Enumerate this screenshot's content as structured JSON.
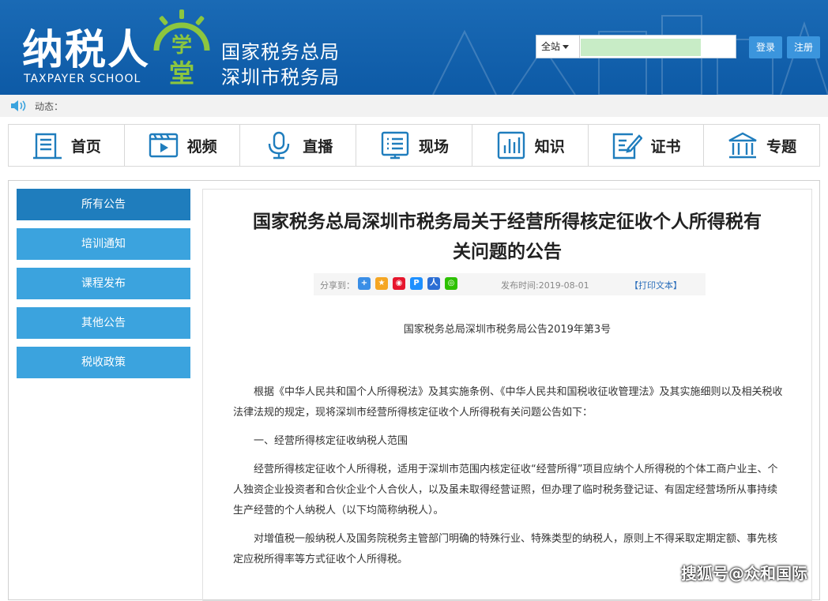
{
  "header": {
    "logo_text": "纳税人",
    "logo_sub": "TAXPAYER SCHOOL",
    "logo_emblem_chars": "学堂",
    "org_line1": "国家税务总局",
    "org_line2": "深圳市税务局",
    "search_scope": "全站",
    "search_value": "",
    "login_label": "登录",
    "register_label": "注册"
  },
  "ticker": {
    "label": "动态："
  },
  "nav": [
    {
      "label": "首页",
      "icon": "home-doc-icon"
    },
    {
      "label": "视频",
      "icon": "video-play-icon"
    },
    {
      "label": "直播",
      "icon": "microphone-icon"
    },
    {
      "label": "现场",
      "icon": "list-board-icon"
    },
    {
      "label": "知识",
      "icon": "bar-chart-icon"
    },
    {
      "label": "证书",
      "icon": "certificate-pen-icon"
    },
    {
      "label": "专题",
      "icon": "building-icon"
    }
  ],
  "sidebar": [
    {
      "label": "所有公告"
    },
    {
      "label": "培训通知"
    },
    {
      "label": "课程发布"
    },
    {
      "label": "其他公告"
    },
    {
      "label": "税收政策"
    }
  ],
  "article": {
    "title_line1": "国家税务总局深圳市税务局关于经营所得核定征收个人所得税有",
    "title_line2": "关问题的公告",
    "share_label": "分享到：",
    "date": "发布时间:2019-08-01",
    "print_label": "【打印文本】",
    "notice_no": "国家税务总局深圳市税务局公告2019年第3号",
    "paragraphs": [
      "根据《中华人民共和国个人所得税法》及其实施条例、《中华人民共和国税收征收管理法》及其实施细则以及相关税收法律法规的规定，现将深圳市经营所得核定征收个人所得税有关问题公告如下：",
      "一、经营所得核定征收纳税人范围",
      "经营所得核定征收个人所得税，适用于深圳市范围内核定征收“经营所得”项目应纳个人所得税的个体工商户业主、个人独资企业投资者和合伙企业个人合伙人，以及虽未取得经营证照，但办理了临时税务登记证、有固定经营场所从事持续生产经营的个人纳税人（以下均简称纳税人）。",
      "对增值税一般纳税人及国务院税务主管部门明确的特殊行业、特殊类型的纳税人，原则上不得采取定期定额、事先核定应税所得率等方式征收个人所得税。"
    ]
  },
  "watermark": "搜狐号@众和国际",
  "colors": {
    "header_blue": "#0d5aa6",
    "sidebar_blue": "#3ba3de",
    "sidebar_active": "#1f7dbd",
    "emblem_green": "#8cc63f"
  }
}
